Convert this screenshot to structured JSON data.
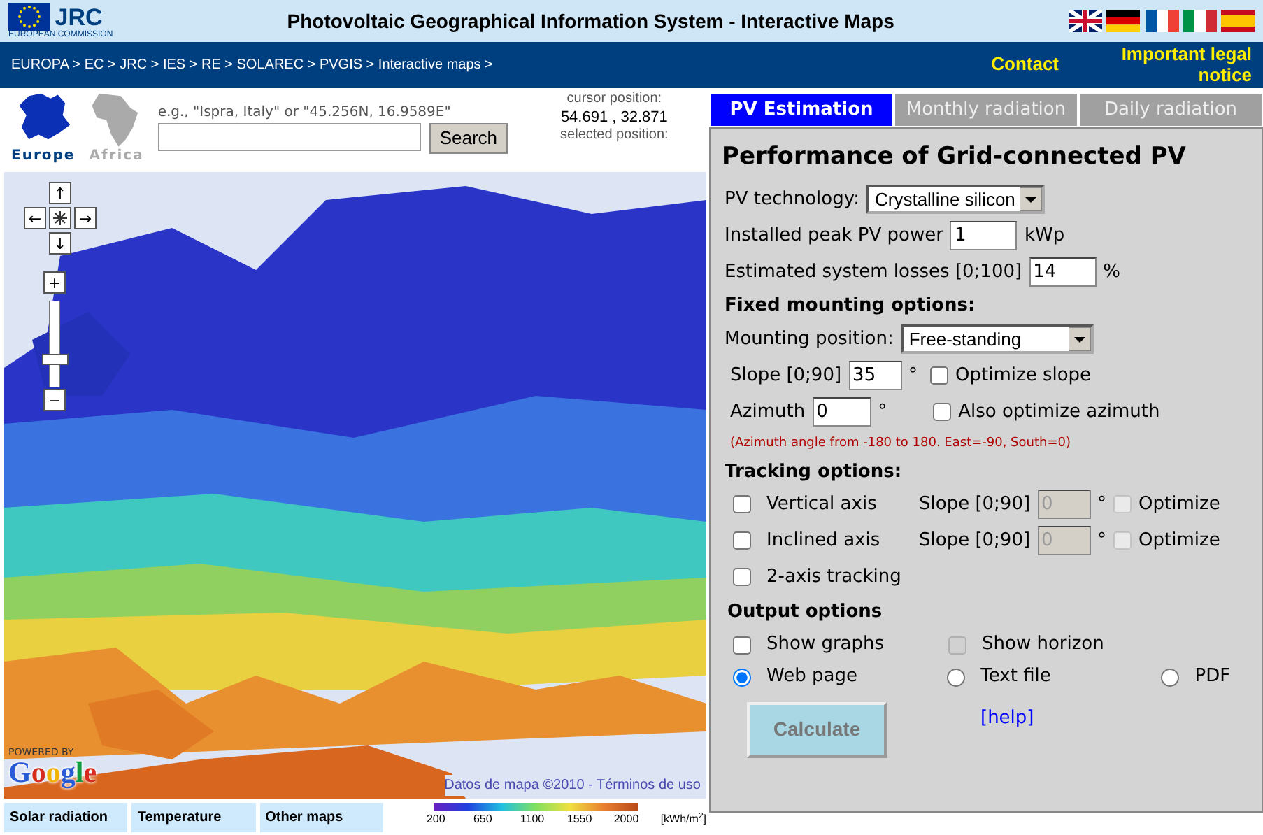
{
  "header": {
    "logo_text": "JRC",
    "logo_subtext": "EUROPEAN COMMISSION",
    "title": "Photovoltaic Geographical Information System - Interactive Maps",
    "languages": [
      {
        "kind": "uk"
      },
      {
        "kind": "de"
      },
      {
        "kind": "fr"
      },
      {
        "kind": "it"
      },
      {
        "kind": "es"
      }
    ]
  },
  "nav": {
    "breadcrumb": "EUROPA > EC > JRC > IES > RE > SOLAREC > PVGIS > Interactive maps >",
    "links": [
      "Contact",
      "Important legal notice"
    ]
  },
  "region_selector": [
    {
      "label": "Europe",
      "selected": true
    },
    {
      "label": "Africa",
      "selected": false
    }
  ],
  "search": {
    "hint": "e.g., \"Ispra, Italy\" or \"45.256N, 16.9589E\"",
    "button": "Search"
  },
  "position": {
    "cursor_label": "cursor position:",
    "cursor_value": "54.691 , 32.871",
    "selected_label": "selected position:"
  },
  "map": {
    "kind": "picture",
    "pan_buttons": [
      "↑",
      "←",
      "→",
      "↓"
    ],
    "zoom_in": "+",
    "zoom_out": "−",
    "zoom": {
      "level": 0.3
    },
    "powered_by": "POWERED BY",
    "logo": "Google",
    "attribution": "Datos de mapa ©2010 - Términos de uso"
  },
  "map_tabs": [
    "Solar radiation",
    "Temperature",
    "Other maps"
  ],
  "legend": {
    "ticks": [
      "200",
      "650",
      "1100",
      "1550",
      "2000"
    ],
    "unit": "[kWh/m$^{2}$]"
  },
  "tabs": [
    {
      "label": "PV Estimation",
      "selected": true
    },
    {
      "label": "Monthly radiation",
      "selected": false
    },
    {
      "label": "Daily radiation",
      "selected": false
    }
  ],
  "form": {
    "title": "Performance of Grid-connected PV",
    "pv_technology": {
      "label": "PV technology:",
      "value": "Crystalline silicon"
    },
    "peak_power": {
      "label": "Installed peak PV power",
      "value": "1",
      "unit": "kWp"
    },
    "losses": {
      "label": "Estimated system losses [0;100]",
      "value": "14",
      "unit": "%"
    },
    "fixed_heading": "Fixed mounting options:",
    "mounting": {
      "label": "Mounting position:",
      "value": "Free-standing"
    },
    "slope": {
      "label": "Slope [0;90]",
      "value": "35",
      "unit": "°",
      "option": {
        "label": "Optimize slope",
        "checked": false
      }
    },
    "azimuth": {
      "label": "Azimuth",
      "value": "0",
      "unit": "°",
      "option": {
        "label": "Also optimize azimuth",
        "checked": false
      }
    },
    "azimuth_note": "(Azimuth angle from -180 to 180. East=-90, South=0)",
    "tracking_heading": "Tracking options:",
    "tracking": [
      {
        "label": "Vertical axis",
        "checked": false,
        "slope_label": "Slope [0;90]",
        "slope_value": "0",
        "unit": "°",
        "disabled": true,
        "optimize": {
          "label": "Optimize",
          "checked": false
        }
      },
      {
        "label": "Inclined axis",
        "checked": false,
        "slope_label": "Slope [0;90]",
        "slope_value": "0",
        "unit": "°",
        "disabled": true,
        "optimize": {
          "label": "Optimize",
          "checked": false
        }
      },
      {
        "label": "2-axis tracking",
        "checked": false
      }
    ],
    "output_heading": "Output options",
    "output_checks": [
      {
        "label": "Show graphs",
        "checked": false,
        "disabled": false
      },
      {
        "label": "Show horizon",
        "checked": false,
        "disabled": true
      }
    ],
    "output_formats": [
      {
        "label": "Web page",
        "selected": true
      },
      {
        "label": "Text file",
        "selected": false
      },
      {
        "label": "PDF",
        "selected": false
      }
    ],
    "calculate": "Calculate",
    "help": "[help]"
  }
}
